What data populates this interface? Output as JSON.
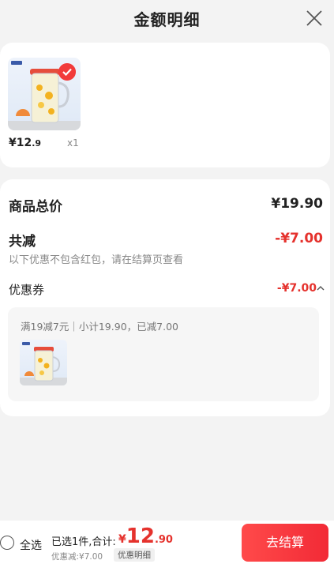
{
  "header": {
    "title": "金额明细"
  },
  "item": {
    "price_int": "¥12",
    "price_dec": ".9",
    "qty": "x1"
  },
  "summary": {
    "total_label": "商品总价",
    "total_value": "¥19.90",
    "reduce_label": "共减",
    "reduce_value": "-¥7.00",
    "reduce_note": "以下优惠不包含红包，请在结算页查看",
    "coupon_label": "优惠券",
    "coupon_value": "-¥7.00",
    "coupon_detail": "满19减7元｜小计19.90，已减7.00"
  },
  "bottom": {
    "select_all": "全选",
    "selected_text": "已选1件,合计:",
    "currency": "¥",
    "amount_int": "12",
    "amount_dec": ".90",
    "discount": "优惠减:¥7.00",
    "detail_tag": "优惠明细",
    "checkout": "去结算"
  },
  "colors": {
    "accent": "#e5322d",
    "button": "#f22a36"
  }
}
